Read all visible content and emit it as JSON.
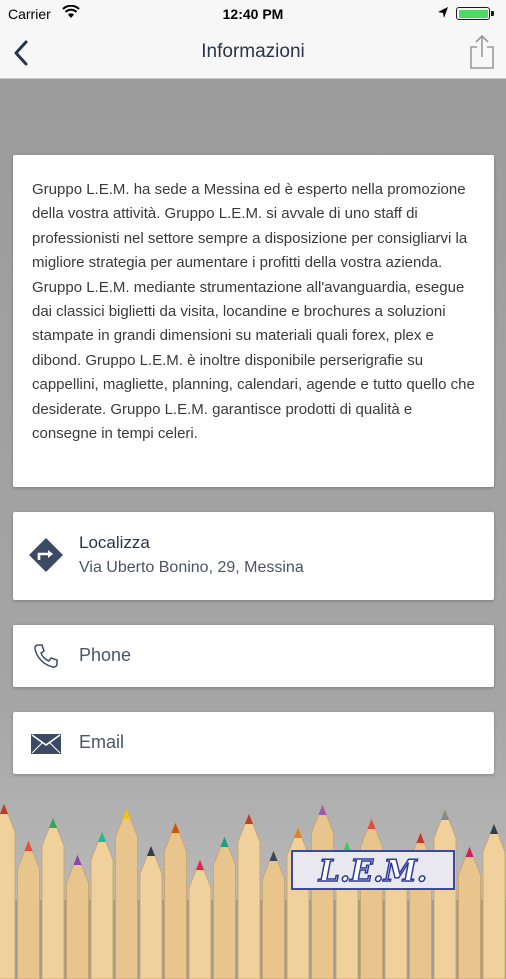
{
  "status": {
    "carrier": "Carrier",
    "time": "12:40 PM",
    "battery_level": 1.0
  },
  "nav": {
    "title": "Informazioni",
    "back_icon": "chevron-left-icon",
    "share_icon": "share-icon"
  },
  "description": "Gruppo L.E.M. ha sede a Messina ed è esperto nella promozione della vostra attività. Gruppo L.E.M. si avvale di uno staff di professionisti nel settore sempre a disposizione per consigliarvi la migliore strategia per aumentare i profitti della vostra azienda. Gruppo L.E.M. mediante strumentazione all'avanguardia, esegue dai classici biglietti da visita, locandine e brochures a soluzioni stampate in grandi dimensioni su materiali quali forex, plex e dibond. Gruppo L.E.M. è inoltre disponibile perserigrafie su cappellini, magliette, planning, calendari, agende e tutto quello che desiderate. Gruppo L.E.M. garantisce prodotti di qualità e consegne in tempi celeri.",
  "location": {
    "title": "Localizza",
    "address": "Via Uberto Bonino, 29, Messina",
    "icon": "directions-icon"
  },
  "phone": {
    "label": "Phone",
    "icon": "phone-icon"
  },
  "email": {
    "label": "Email",
    "icon": "envelope-icon"
  },
  "background_logo": "L.E.M.",
  "colors": {
    "accent": "#2a3447",
    "navbar": "#f7f7f7",
    "background": "#9b9b9b"
  }
}
